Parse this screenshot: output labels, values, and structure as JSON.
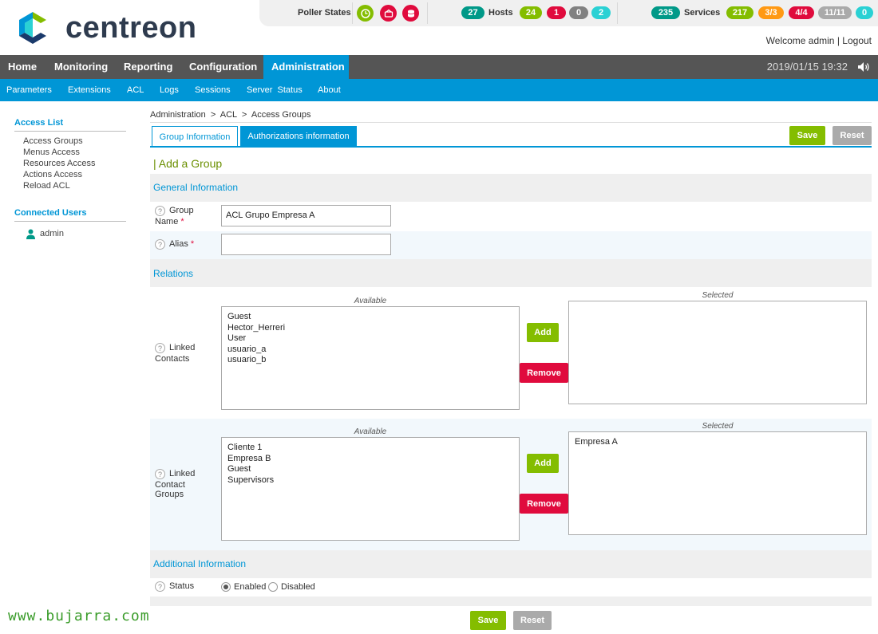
{
  "brand": {
    "name": "centreon"
  },
  "topbar": {
    "poller_label": "Poller States",
    "hosts_label": "Hosts",
    "hosts": {
      "total": "27",
      "up": "24",
      "down": "1",
      "unreachable": "0",
      "pending": "2"
    },
    "services_label": "Services",
    "services": {
      "total": "235",
      "ok": "217",
      "warning": "3/3",
      "critical": "4/4",
      "unknown": "11/11",
      "pending": "0"
    },
    "welcome": "Welcome admin",
    "separator": "|",
    "logout": "Logout"
  },
  "nav": {
    "main": [
      "Home",
      "Monitoring",
      "Reporting",
      "Configuration",
      "Administration"
    ],
    "active": "Administration",
    "datetime": "2019/01/15 19:32",
    "sub": [
      "Parameters",
      "Extensions",
      "ACL",
      "Logs",
      "Sessions",
      "Server  Status",
      "About"
    ]
  },
  "sidebar": {
    "access_list_title": "Access List",
    "links": [
      "Access Groups",
      "Menus Access",
      "Resources Access",
      "Actions Access",
      "Reload ACL"
    ],
    "connected_title": "Connected Users",
    "users": [
      "admin"
    ]
  },
  "breadcrumb": {
    "parts": [
      "Administration",
      ">",
      "ACL",
      ">",
      "Access Groups"
    ]
  },
  "tabs": [
    "Group Information",
    "Authorizations information"
  ],
  "buttons": {
    "save": "Save",
    "reset": "Reset",
    "add": "Add",
    "remove": "Remove"
  },
  "form": {
    "title": "| Add a Group",
    "general_section": "General Information",
    "group_name_label_1": "Group",
    "group_name_label_2": "Name",
    "required": "*",
    "group_name_value": "ACL Grupo Empresa A",
    "alias_label": "Alias",
    "alias_value": "",
    "relations_section": "Relations",
    "linked_contacts_label_1": "Linked",
    "linked_contacts_label_2": "Contacts",
    "linked_groups_label_1": "Linked",
    "linked_groups_label_2": "Contact",
    "linked_groups_label_3": "Groups",
    "available_caption": "Available",
    "selected_caption": "Selected",
    "contacts_available": [
      "Guest",
      "Hector_Herreri",
      "User",
      "usuario_a",
      "usuario_b"
    ],
    "contacts_selected": [],
    "groups_available": [
      "Cliente 1",
      "Empresa B",
      "Guest",
      "Supervisors"
    ],
    "groups_selected": [
      "Empresa A"
    ],
    "additional_section": "Additional Information",
    "status_label": "Status",
    "status_enabled": "Enabled",
    "status_disabled": "Disabled",
    "status_value": "Enabled"
  },
  "watermark": "www.bujarra.com",
  "colors": {
    "accent": "#0096d6",
    "nav": "#555555",
    "ok": "#84bd00",
    "critical": "#e00b3d",
    "warning": "#ff9913",
    "unknown": "#aaaaaa",
    "pending": "#2ad1d4",
    "total": "#009988"
  }
}
